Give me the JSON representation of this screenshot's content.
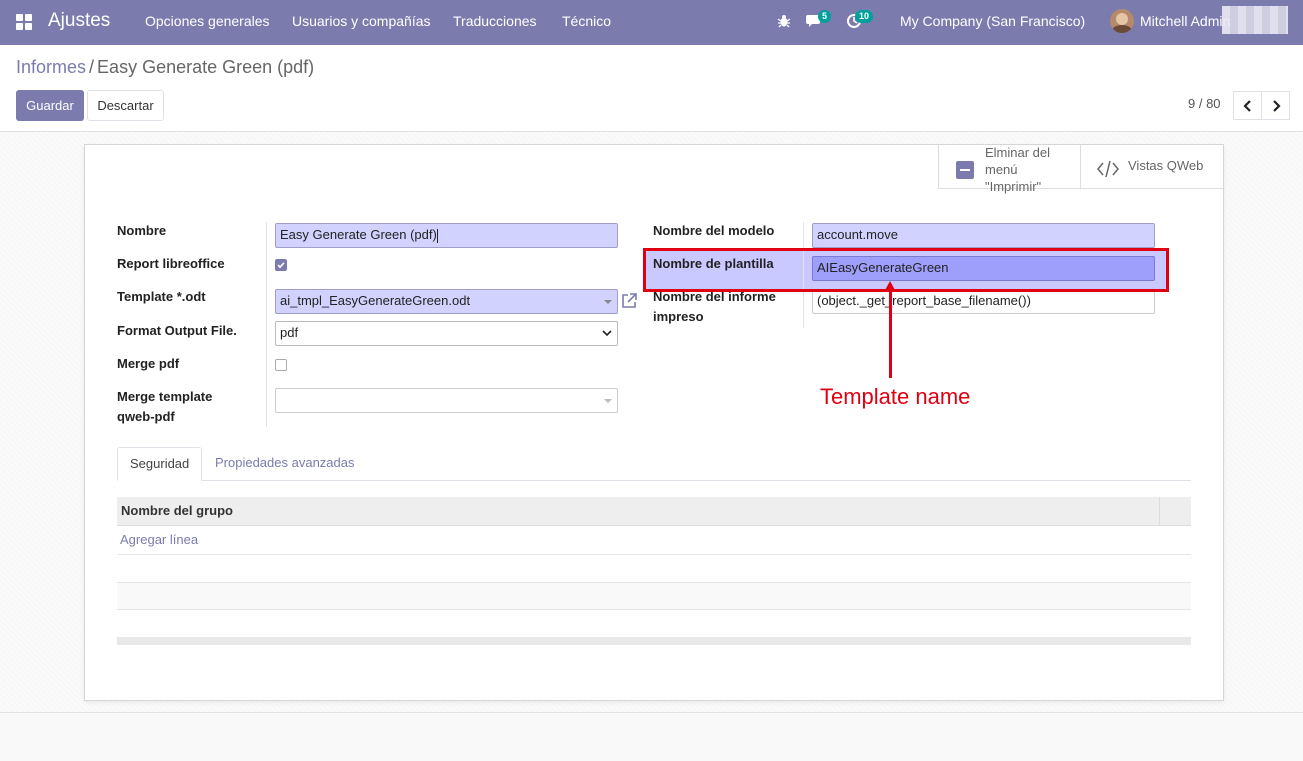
{
  "navbar": {
    "brand": "Ajustes",
    "menu": [
      "Opciones generales",
      "Usuarios y compañías",
      "Traducciones",
      "Técnico"
    ],
    "chat_count": "5",
    "activity_count": "10",
    "company": "My Company (San Francisco)",
    "user": "Mitchell Admin"
  },
  "breadcrumb": {
    "parent": "Informes",
    "separator": "/",
    "current": "Easy Generate Green (pdf)"
  },
  "actions": {
    "save": "Guardar",
    "discard": "Descartar"
  },
  "pager": {
    "value": "9 / 80"
  },
  "smart_buttons": {
    "remove_print": [
      "Elminar del",
      "menú",
      "\"Imprimir\""
    ],
    "qweb": "Vistas QWeb"
  },
  "form": {
    "name_label": "Nombre",
    "name_value": "Easy Generate Green (pdf)",
    "libreoffice_label": "Report libreoffice",
    "libreoffice_checked": true,
    "template_label": "Template *.odt",
    "template_value": "ai_tmpl_EasyGenerateGreen.odt",
    "format_label": "Format Output File.",
    "format_value": "pdf",
    "merge_pdf_label": "Merge pdf",
    "merge_pdf_checked": false,
    "merge_template_label_1": "Merge template",
    "merge_template_label_2": "qweb-pdf",
    "merge_template_value": "",
    "model_label": "Nombre del modelo",
    "model_value": "account.move",
    "template_name_label": "Nombre de plantilla",
    "template_name_value": "AIEasyGenerateGreen",
    "print_name_label_1": "Nombre del informe",
    "print_name_label_2": "impreso",
    "print_name_value": "(object._get_report_base_filename())"
  },
  "annotation": {
    "text": "Template name",
    "color": "#e00012"
  },
  "notebook": {
    "tabs": [
      "Seguridad",
      "Propiedades avanzadas"
    ],
    "column": "Nombre del grupo",
    "add_line": "Agregar línea"
  },
  "colors": {
    "brand": "#7c7bad",
    "required_field": "#d2d2ff",
    "badge": "#00a09d"
  }
}
